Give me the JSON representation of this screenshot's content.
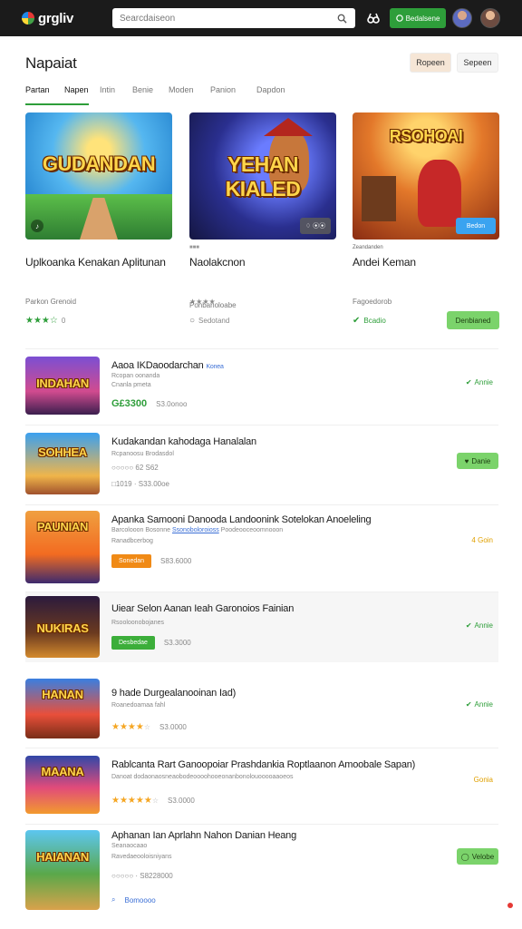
{
  "topbar": {
    "logo_text": "grgliv",
    "search_placeholder": "Searcdaiseon",
    "signin_label": "Bedalsene"
  },
  "header": {
    "title": "Napaiat",
    "primary_button": "Ropeen",
    "secondary_button": "Sepeen"
  },
  "tabs": [
    "Partan",
    "Napen",
    "Intin",
    "Benie",
    "Moden",
    "Panion",
    "Dapdon"
  ],
  "featured": [
    {
      "thumb_title": "GUDANDAN",
      "meta_top": "",
      "title": "Uplkoanka Kenakan Aplitunan",
      "sub": "Parkon Grenoid",
      "stars": "★★★☆",
      "count": "0",
      "badge": "",
      "button": ""
    },
    {
      "thumb_title": "YEHAN KIALED",
      "meta_top": "■■■",
      "title": "Naolakcnon",
      "sub": "Ponbanoloabe",
      "stars": "★★★★",
      "count": "",
      "badge": "♢ ⦿⦿",
      "button": "",
      "extra": "Sedotand"
    },
    {
      "thumb_title": "RSOHOAI",
      "meta_top": "Zeandanden",
      "title": "Andei Keman",
      "sub": "Fagoedorob",
      "stars": "",
      "count": "",
      "badge": "Bedon",
      "button": "Denbianed",
      "check_label": "Bcadio"
    }
  ],
  "list": [
    {
      "thumb_title": "INDAHAN",
      "title": "Aaoa IKDaoodarchan",
      "title_tag": "Konea",
      "sub": "Rcopan oonanda",
      "sub2": "Cnanla pmeta",
      "price": "G£3300",
      "count": "S3.0onoo",
      "action": "Annie",
      "action_type": "check"
    },
    {
      "thumb_title": "SOHHEA",
      "title": "Kudakandan kahodaga Hanalalan",
      "sub": "Rcpanoosu Brodasdol",
      "line3a": "○○○○○ 62 S62",
      "line3b": "□1019 ·  S33.00oe",
      "action": "Danie",
      "action_type": "btn"
    },
    {
      "thumb_title": "PAUNIAN",
      "title": "Apanka Samooni Danooda Landoonink Sotelokan Anoeleling",
      "sub": "Barcolooon Bosonne",
      "sub_link": "Ssonoboloroioss",
      "sub_tail": "Poodeooceoomnooon",
      "sub2": "Ranadbcerbog",
      "tag": "Sonedan",
      "tag_color": "orange",
      "count": "S83.6000",
      "action": "4 Goin",
      "action_type": "orange"
    },
    {
      "thumb_title": "NUKIRAS",
      "title": "Uiear Selon Aanan Ieah Garonoios Fainian",
      "sub": "Rsooloonobojanes",
      "tag": "Desbedae",
      "tag_color": "green",
      "count": "S3.3000",
      "action": "Annie",
      "action_type": "check"
    },
    {
      "thumb_title": "HANAN",
      "title": "9 hade Durgealanooinan Iad)",
      "sub": "Roanedoamaa fahl",
      "stars": "★★★★",
      "stars_grey": "☆",
      "count": "S3.0000",
      "action": "Annie",
      "action_type": "check"
    },
    {
      "thumb_title": "MAANA",
      "title": "Rablcanta Rart Ganoopoiar Prashdankia Roptlaanon Amoobale Sapan)",
      "sub": "Danoat dodaonaosneaobodeoooohooeonanbonolouooooaaoeos",
      "stars": "★★★★★",
      "stars_grey": "☆",
      "count": "S3.0000",
      "action": "Gonia",
      "action_type": "orange"
    },
    {
      "thumb_title": "HAIANAN",
      "title": "Aphanan Ian Aprlahn Nahon Danian Heang",
      "sub": "Seanaocaao",
      "sub2": "Ravedaeooloisniyans",
      "line3a": "○○○○○ ·  S8228000",
      "link": "Bomoooo",
      "action": "Velobe",
      "action_type": "btn"
    }
  ],
  "colors": {
    "accent_green": "#2e9e3a",
    "button_green": "#7bd36b",
    "orange": "#f08a16",
    "topbar": "#1b1b1b"
  }
}
